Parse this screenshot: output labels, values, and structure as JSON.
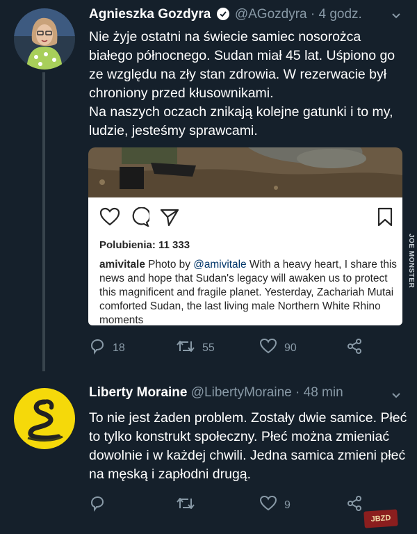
{
  "tweets": [
    {
      "author_name": "Agnieszka Gozdyra",
      "author_handle": "@AGozdyra",
      "time": "· 4 godz.",
      "text": [
        "Nie żyje ostatni na świecie samiec nosorożca białego północnego. Sudan miał 45 lat. Uśpiono go ze względu na zły stan zdrowia. W rezerwacie był chroniony przed kłusownikami.",
        "Na naszych oczach znikają kolejne gatunki i to my, ludzie, jesteśmy sprawcami."
      ],
      "instagram": {
        "likes_label": "Polubienia: 11 333",
        "caption_user": "amivitale",
        "caption_prefix": "Photo by",
        "caption_mention": "@amivitale",
        "caption_text": "With a heavy heart, I share this news and hope that Sudan's legacy will awaken us to protect this magnificent and fragile planet. Yesterday, Zachariah Mutai comforted Sudan, the last living male Northern White Rhino moments"
      },
      "replies": "18",
      "retweets": "55",
      "likes": "90"
    },
    {
      "author_name": "Liberty Moraine",
      "author_handle": "@LibertyMoraine",
      "time": "· 48 min",
      "text": [
        "To nie jest żaden problem. Zostały dwie samice. Płeć to tylko konstrukt społeczny. Płeć można zmieniać dowolnie i w każdej chwili. Jedna samica zmieni płeć na męską i zapłodni drugą."
      ],
      "replies": "",
      "retweets": "",
      "likes": "9"
    }
  ],
  "watermark": "JOE MONSTER",
  "badge": "JBZD",
  "colors": {
    "background": "#15202b",
    "secondary_text": "#8899a6",
    "verified": "#ffffff",
    "avatar_yellow": "#f5d90a"
  },
  "icons": [
    "verified-icon",
    "chevron-down-icon",
    "reply-icon",
    "retweet-icon",
    "like-icon",
    "share-icon",
    "heart-icon",
    "comment-icon",
    "send-icon",
    "bookmark-icon"
  ]
}
